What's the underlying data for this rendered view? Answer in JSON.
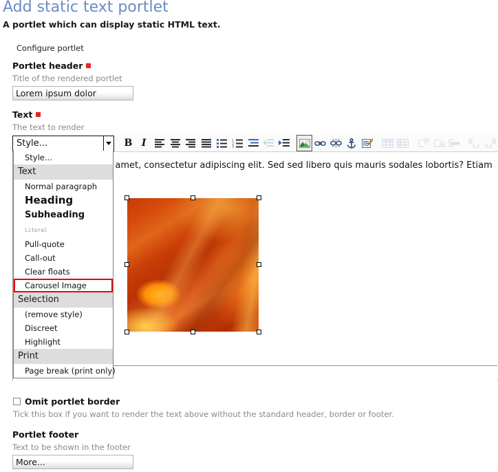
{
  "page": {
    "title": "Add static text portlet",
    "description": "A portlet which can display static HTML text.",
    "legend": "Configure portlet"
  },
  "colors": {
    "title": "#6a8bc4",
    "required_marker": "#ee2222",
    "selection_outline": "#e30613",
    "help_text": "#8a8a8a"
  },
  "fields": {
    "portlet_header": {
      "label": "Portlet header",
      "required": true,
      "help": "Title of the rendered portlet",
      "value": "Lorem ipsum dolor"
    },
    "text": {
      "label": "Text",
      "required": true,
      "help": "The text to render"
    },
    "omit_border": {
      "label": "Omit portlet border",
      "checked": false,
      "help": "Tick this box if you want to render the text above without the standard header, border or footer."
    },
    "portlet_footer": {
      "label": "Portlet footer",
      "required": false,
      "help": "Text to be shown in the footer",
      "value": "More..."
    }
  },
  "editor": {
    "style_select": {
      "value": "Style...",
      "open": true,
      "icon": "chevron-down-icon"
    },
    "toolbar": [
      {
        "name": "bold-button",
        "glyph": "B",
        "label": "Bold",
        "state": "enabled"
      },
      {
        "name": "italic-button",
        "glyph": "I",
        "label": "Italic",
        "state": "enabled"
      },
      {
        "name": "align-left-button",
        "glyph": "",
        "label": "Align left",
        "state": "enabled"
      },
      {
        "name": "align-center-button",
        "glyph": "",
        "label": "Align center",
        "state": "enabled"
      },
      {
        "name": "align-right-button",
        "glyph": "",
        "label": "Align right",
        "state": "enabled"
      },
      {
        "name": "align-justify-button",
        "glyph": "",
        "label": "Justify",
        "state": "enabled"
      },
      {
        "name": "bulleted-list-button",
        "glyph": "",
        "label": "Bulleted list",
        "state": "enabled"
      },
      {
        "name": "numbered-list-button",
        "glyph": "",
        "label": "Numbered list",
        "state": "enabled"
      },
      {
        "name": "definition-list-button",
        "glyph": "",
        "label": "Definition list",
        "state": "enabled"
      },
      {
        "name": "outdent-button",
        "glyph": "",
        "label": "Outdent",
        "state": "disabled"
      },
      {
        "name": "indent-button",
        "glyph": "",
        "label": "Indent",
        "state": "enabled"
      },
      {
        "name": "insert-image-button",
        "glyph": "",
        "label": "Insert image",
        "state": "active"
      },
      {
        "name": "insert-link-button",
        "glyph": "",
        "label": "Insert link",
        "state": "enabled"
      },
      {
        "name": "unlink-button",
        "glyph": "",
        "label": "Unlink",
        "state": "enabled"
      },
      {
        "name": "anchor-button",
        "glyph": "",
        "label": "Insert anchor",
        "state": "enabled"
      },
      {
        "name": "edit-html-button",
        "glyph": "",
        "label": "Edit HTML source",
        "state": "enabled"
      },
      {
        "name": "insert-table-button",
        "glyph": "",
        "label": "Insert table",
        "state": "disabled"
      },
      {
        "name": "table-properties-button",
        "glyph": "",
        "label": "Table properties",
        "state": "disabled"
      },
      {
        "name": "insert-row-before-button",
        "glyph": "",
        "label": "Insert row before",
        "state": "disabled"
      },
      {
        "name": "insert-row-after-button",
        "glyph": "",
        "label": "Insert row after",
        "state": "disabled"
      },
      {
        "name": "delete-row-button",
        "glyph": "",
        "label": "Delete row",
        "state": "disabled"
      },
      {
        "name": "insert-column-before-button",
        "glyph": "",
        "label": "Insert column before",
        "state": "disabled"
      },
      {
        "name": "insert-column-after-button",
        "glyph": "",
        "label": "Insert column after",
        "state": "disabled"
      }
    ],
    "content": {
      "paragraph": "Lorem ipsum dolor sit amet, consectetur adipiscing elit. Sed sed libero quis mauris sodales lobortis? Etiam libero nunc.",
      "image": {
        "name": "orange-flower-image",
        "selected": true,
        "handles": 8
      }
    }
  },
  "style_menu": {
    "items": [
      {
        "label": "Style...",
        "type": "placeholder",
        "style": "normal",
        "selected": false
      },
      {
        "label": "Text",
        "type": "group",
        "style": "group",
        "selected": false
      },
      {
        "label": "Normal paragraph",
        "type": "item",
        "style": "normal",
        "selected": false
      },
      {
        "label": "Heading",
        "type": "item",
        "style": "heading",
        "selected": false
      },
      {
        "label": "Subheading",
        "type": "item",
        "style": "subheading",
        "selected": false
      },
      {
        "label": "Literal",
        "type": "item",
        "style": "literal",
        "selected": false
      },
      {
        "label": "Pull-quote",
        "type": "item",
        "style": "normal",
        "selected": false
      },
      {
        "label": "Call-out",
        "type": "item",
        "style": "normal",
        "selected": false
      },
      {
        "label": "Clear floats",
        "type": "item",
        "style": "normal",
        "selected": false
      },
      {
        "label": "Carousel Image",
        "type": "item",
        "style": "normal",
        "selected": true
      },
      {
        "label": "Selection",
        "type": "group",
        "style": "group",
        "selected": false
      },
      {
        "label": "(remove style)",
        "type": "item",
        "style": "normal",
        "selected": false
      },
      {
        "label": "Discreet",
        "type": "item",
        "style": "normal",
        "selected": false
      },
      {
        "label": "Highlight",
        "type": "item",
        "style": "normal",
        "selected": false
      },
      {
        "label": "Print",
        "type": "group",
        "style": "group",
        "selected": false
      },
      {
        "label": "Page break (print only)",
        "type": "item",
        "style": "normal",
        "selected": false
      }
    ]
  }
}
